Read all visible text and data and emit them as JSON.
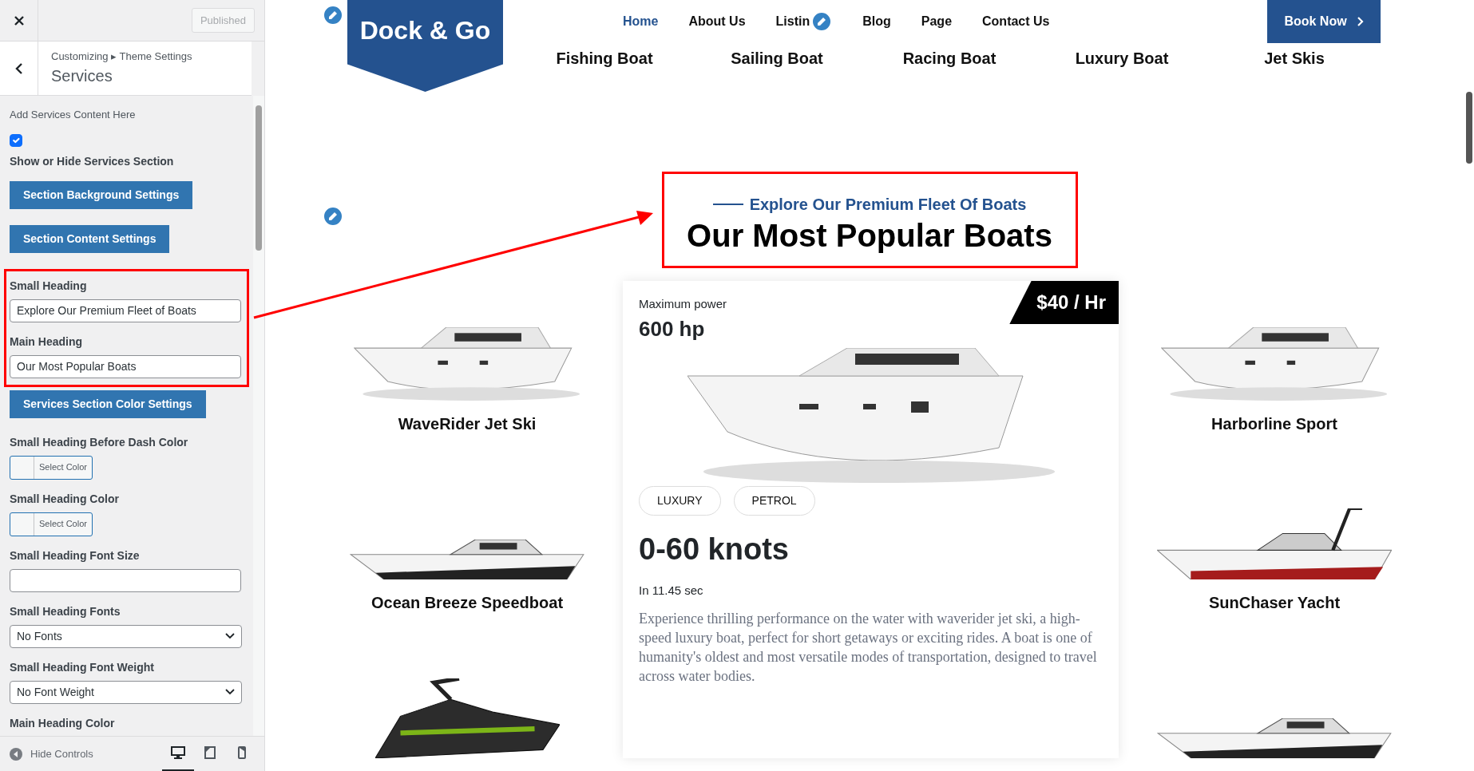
{
  "customizer": {
    "publish_button": {
      "label": "Published",
      "disabled": true
    },
    "breadcrumb": "Customizing ▸ Theme Settings",
    "section_title": "Services",
    "controls": [
      {
        "kind": "description",
        "text": "Add Services Content Here"
      },
      {
        "kind": "checkbox",
        "label": "Show or Hide Services Section",
        "checked": true
      },
      {
        "kind": "button",
        "label": "Section Background Settings"
      },
      {
        "kind": "button",
        "label": "Section Content Settings"
      },
      {
        "kind": "group",
        "highlighted": true,
        "items": [
          {
            "kind": "text",
            "label": "Small Heading",
            "value": "Explore Our Premium Fleet of Boats"
          },
          {
            "kind": "text",
            "label": "Main Heading",
            "value": "Our Most Popular Boats"
          }
        ]
      },
      {
        "kind": "button",
        "label": "Services Section Color Settings"
      },
      {
        "kind": "color",
        "label": "Small Heading Before Dash Color",
        "button": "Select Color"
      },
      {
        "kind": "color",
        "label": "Small Heading Color",
        "button": "Select Color"
      },
      {
        "kind": "text",
        "label": "Small Heading Font Size"
      },
      {
        "kind": "select",
        "label": "Small Heading Fonts",
        "value": "No Fonts"
      },
      {
        "kind": "select",
        "label": "Small Heading Font Weight",
        "value": "No Font Weight"
      },
      {
        "kind": "heading",
        "label": "Main Heading Color"
      }
    ],
    "footer": {
      "hide_controls": "Hide Controls",
      "devices": [
        {
          "kind": "desktop",
          "selected": true
        },
        {
          "kind": "tablet",
          "selected": false
        },
        {
          "kind": "mobile",
          "selected": false
        }
      ]
    }
  },
  "site": {
    "logo": "Dock & Go",
    "nav": [
      {
        "label": "Home",
        "selected": true
      },
      {
        "label": "About Us",
        "selected": false
      },
      {
        "label": "Listin",
        "selected": false
      },
      {
        "label": "Blog",
        "selected": false
      },
      {
        "label": "Page",
        "selected": false
      },
      {
        "label": "Contact Us",
        "selected": false
      }
    ],
    "book_button": "Book Now",
    "categories": [
      "Fishing Boat",
      "Sailing Boat",
      "Racing Boat",
      "Luxury Boat",
      "Jet Skis"
    ],
    "section": {
      "small_heading": "Explore Our Premium Fleet Of Boats",
      "main_heading": "Our Most Popular Boats",
      "highlighted": true
    },
    "boats_left": [
      {
        "kind": "yacht",
        "name": "WaveRider Jet Ski"
      },
      {
        "kind": "speedboat",
        "name": "Ocean Breeze Speedboat"
      },
      {
        "kind": "jetski"
      }
    ],
    "featured": {
      "power_label": "Maximum power",
      "power": "600 hp",
      "price": "$40 / Hr",
      "tags": [
        "LUXURY",
        "PETROL"
      ],
      "speed": "0-60 knots",
      "speed_time": "In 11.45 sec",
      "description": "Experience thrilling performance on the water with waverider jet ski, a high-speed luxury boat, perfect for short getaways or exciting rides. A boat is one of humanity's oldest and most versatile modes of transportation, designed to travel across water bodies."
    },
    "boats_right": [
      {
        "kind": "yacht",
        "name": "Harborline Sport"
      },
      {
        "kind": "sportboat",
        "name": "SunChaser Yacht"
      },
      {
        "kind": "speedboat"
      }
    ]
  }
}
